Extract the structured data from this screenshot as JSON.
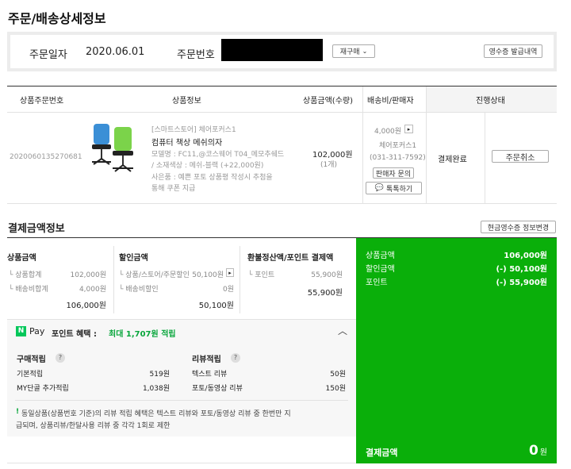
{
  "page_title": "주문/배송상세정보",
  "order_bar": {
    "date_label": "주문일자",
    "date_value": "2020.06.01",
    "number_label": "주문번호",
    "reorder_button": "재구매",
    "receipt_button": "영수증 발급내역"
  },
  "table": {
    "headers": [
      "상품주문번호",
      "상품정보",
      "상품금액(수량)",
      "배송비/판매자",
      "진행상태"
    ],
    "row": {
      "order_number": "2020060135270681",
      "store": "[스마트스토어] 체어포커스1",
      "product_name": "컴퓨터 책상 메쉬의자",
      "model_line1": "모델명 : FC11,@코스웨어 T04_메모추쉐드",
      "model_line2": "/ 소재색상 : 메쉬-블랙 (+22,000원)",
      "note_line1": "사은품 : 예쁜 포토 상품평 작성시 추첨을",
      "note_line2": "통해 쿠폰 지급",
      "price": "102,000원",
      "quantity": "(1개)",
      "shipping_fee": "4,000원",
      "seller": "체어포커스1",
      "phone": "(031-311-7592)",
      "seller_inquiry_button": "판매자 문의",
      "talktalk_button": "톡톡하기",
      "status": "결제완료",
      "cancel_button": "주문취소"
    }
  },
  "payment": {
    "section_title": "결제금액정보",
    "cash_receipt_button": "현금영수증 정보변경",
    "col1": {
      "title": "상품금액",
      "rows": [
        {
          "label": "└ 상품합계",
          "value": "102,000원"
        },
        {
          "label": "└ 배송비합계",
          "value": "4,000원"
        }
      ],
      "total": "106,000원"
    },
    "col2": {
      "title": "할인금액",
      "rows": [
        {
          "label": "└ 상품/스토어/주문할인",
          "value": "50,100원"
        },
        {
          "label": "└ 배송비할인",
          "value": "0원"
        }
      ],
      "total": "50,100원"
    },
    "col3": {
      "title": "환불정산액/포인트 결제액",
      "rows": [
        {
          "label": "└ 포인트",
          "value": "55,900원"
        }
      ],
      "total": "55,900원"
    },
    "summary": {
      "rows": [
        {
          "label": "상품금액",
          "value": "106,000원"
        },
        {
          "label": "할인금액",
          "value": "(-) 50,100원"
        },
        {
          "label": "포인트",
          "value": "(-) 55,900원"
        }
      ],
      "final_label": "결제금액",
      "final_value": "0",
      "final_unit": "원",
      "bg_color": "#0aaf0a"
    }
  },
  "npay": {
    "logo_n": "N",
    "logo_pay": "Pay",
    "title": "포인트 혜택 :",
    "highlight": "최대 1,707원 적립",
    "purchase": {
      "title": "구매적립",
      "rows": [
        {
          "label": "기본적립",
          "value": "519원"
        },
        {
          "label": "MY단골 추가적립",
          "value": "1,038원"
        }
      ]
    },
    "review": {
      "title": "리뷰적립",
      "rows": [
        {
          "label": "텍스트 리뷰",
          "value": "50원"
        },
        {
          "label": "포토/동영상 리뷰",
          "value": "150원"
        }
      ]
    },
    "notice_mark": "!",
    "notice_line1": "동일상품(상품번호 기준)의 리뷰 적립 혜택은 텍스트 리뷰와 포토/동영상 리뷰 중 한번만 지",
    "notice_line2": "급되며, 상품리뷰/한달사용 리뷰 중 각각 1회로 제한"
  }
}
